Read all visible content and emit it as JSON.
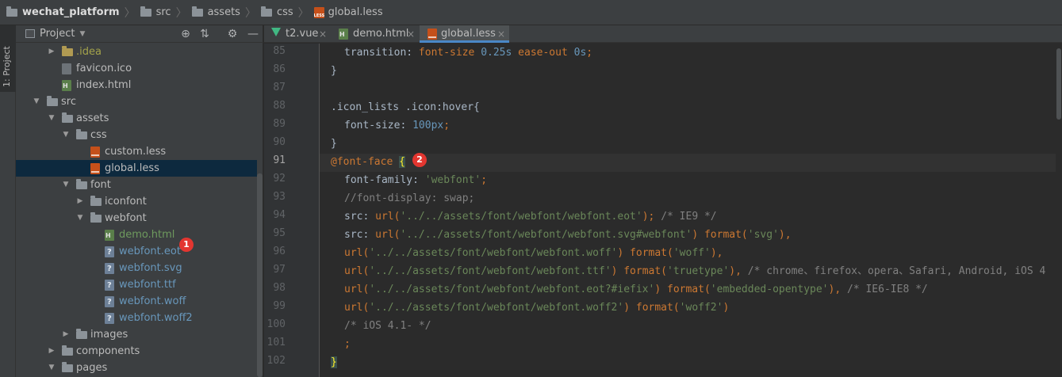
{
  "breadcrumb": {
    "project": "wechat_platform",
    "src": "src",
    "assets": "assets",
    "css": "css",
    "file": "global.less"
  },
  "stripe": {
    "project_tab": "1: Project"
  },
  "project_panel": {
    "title": "Project",
    "tree": [
      {
        "label": ".idea"
      },
      {
        "label": "favicon.ico"
      },
      {
        "label": "index.html"
      },
      {
        "label": "src"
      },
      {
        "label": "assets"
      },
      {
        "label": "css"
      },
      {
        "label": "custom.less"
      },
      {
        "label": "global.less"
      },
      {
        "label": "font"
      },
      {
        "label": "iconfont"
      },
      {
        "label": "webfont"
      },
      {
        "label": "demo.html"
      },
      {
        "label": "webfont.eot"
      },
      {
        "label": "webfont.svg"
      },
      {
        "label": "webfont.ttf"
      },
      {
        "label": "webfont.woff"
      },
      {
        "label": "webfont.woff2"
      },
      {
        "label": "images"
      },
      {
        "label": "components"
      },
      {
        "label": "pages"
      }
    ],
    "badge": "1"
  },
  "tabs": [
    {
      "label": "t2.vue",
      "close": "×"
    },
    {
      "label": "demo.html",
      "close": "×"
    },
    {
      "label": "global.less",
      "close": "×"
    }
  ],
  "editor": {
    "line_numbers": [
      "85",
      "86",
      "87",
      "88",
      "89",
      "90",
      "91",
      "92",
      "93",
      "94",
      "95",
      "96",
      "97",
      "98",
      "99",
      "100",
      "101",
      "102"
    ],
    "current_line": "91",
    "badge": "2",
    "lines": {
      "l85": [
        "transition: ",
        "font-size ",
        "0.25s ",
        "ease-out ",
        "0s",
        ";"
      ],
      "l86": "}",
      "l88": [
        ".icon_lists .icon",
        ":hover",
        "{"
      ],
      "l89": [
        "font-size: ",
        "100px",
        ";"
      ],
      "l90": "}",
      "l91": [
        "@font-face ",
        "{"
      ],
      "l92": [
        "font-family: ",
        "'webfont'",
        ";"
      ],
      "l93": "//font-display: swap;",
      "l94": [
        "src: ",
        "url(",
        "'../../assets/font/webfont/webfont.eot'",
        "); ",
        "/* IE9 */"
      ],
      "l95": [
        "src: ",
        "url(",
        "'../../assets/font/webfont/webfont.svg#webfont'",
        ") ",
        "format(",
        "'svg'",
        "),"
      ],
      "l96": [
        "url(",
        "'../../assets/font/webfont/webfont.woff'",
        ") ",
        "format(",
        "'woff'",
        "),"
      ],
      "l97": [
        "url(",
        "'../../assets/font/webfont/webfont.ttf'",
        ") ",
        "format(",
        "'truetype'",
        "), ",
        "/* chrome、firefox、opera、Safari, Android, iOS 4"
      ],
      "l98": [
        "url(",
        "'../../assets/font/webfont/webfont.eot?#iefix'",
        ") ",
        "format(",
        "'embedded-opentype'",
        "), ",
        "/* IE6-IE8 */"
      ],
      "l99": [
        "url(",
        "'../../assets/font/webfont/webfont.woff2'",
        ") ",
        "format(",
        "'woff2'",
        ")"
      ],
      "l100": "/* iOS 4.1- */",
      "l101": ";",
      "l102": "}"
    }
  },
  "colors": {
    "keyword": "#cc7832",
    "string": "#6a8759",
    "number": "#6897bb",
    "comment": "#808080",
    "badge": "#e33630"
  }
}
